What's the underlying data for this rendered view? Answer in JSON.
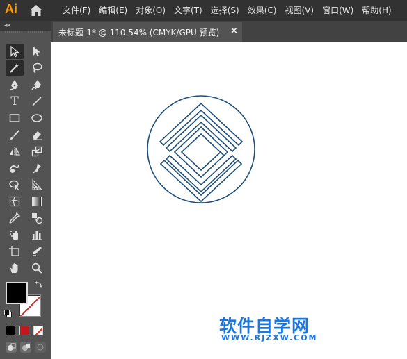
{
  "app": {
    "logo_text": "Ai"
  },
  "menu": {
    "items": [
      "文件(F)",
      "编辑(E)",
      "对象(O)",
      "文字(T)",
      "选择(S)",
      "效果(C)",
      "视图(V)",
      "窗口(W)",
      "帮助(H)"
    ]
  },
  "panel": {
    "collapse_glyph": "◂◂"
  },
  "tab": {
    "title": "未标题-1* @ 110.54% (CMYK/GPU 预览)",
    "close_glyph": "×"
  },
  "toolbar": {
    "type_tool_glyph": "T",
    "tools": [
      "selection-tool",
      "direct-selection-tool",
      "magic-wand-tool",
      "lasso-tool",
      "pen-tool",
      "curvature-tool",
      "type-tool",
      "line-segment-tool",
      "rectangle-tool",
      "ellipse-tool",
      "paintbrush-tool",
      "eraser-tool",
      "reflect-tool",
      "scale-tool",
      "warp-tool",
      "puppet-warp-tool",
      "shape-builder-tool",
      "perspective-grid-tool",
      "mesh-tool",
      "gradient-tool",
      "eyedropper-tool",
      "blend-tool",
      "symbol-sprayer-tool",
      "column-graph-tool",
      "artboard-tool",
      "slice-tool",
      "hand-tool",
      "zoom-tool"
    ],
    "fill_color": "#000000",
    "stroke_color": "none"
  },
  "colors": {
    "logo_stroke": "#1F4E79",
    "watermark": "#1B78E3",
    "menubar_bg": "#323232",
    "panel_bg": "#535353"
  },
  "watermark": {
    "text": "软件自学网",
    "url": "WWW.RJZXW.COM"
  }
}
